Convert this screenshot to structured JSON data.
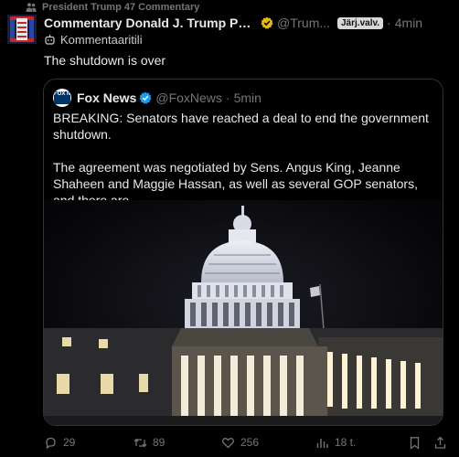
{
  "context": {
    "label": "President Trump 47 Commentary",
    "icon": "people-icon"
  },
  "post": {
    "display_name": "Commentary Donald J. Trump Posts F...",
    "handle": "@Trum...",
    "tag": "Järj.valv.",
    "time": "4min",
    "account_label": "Kommentaaritili",
    "text": "The shutdown is over"
  },
  "quote": {
    "name": "Fox News",
    "handle": "@FoxNews",
    "time": "5min",
    "logo_text": "FOX NEWS",
    "paragraph1": "BREAKING: Senators have reached a deal to end the government shutdown.",
    "paragraph2": "The agreement was negotiated by Sens. Angus King, Jeanne Shaheen and Maggie Hassan, as well as several GOP senators, and there are ..."
  },
  "actions": {
    "replies": "29",
    "reposts": "89",
    "likes": "256",
    "views": "18 t."
  },
  "colors": {
    "background": "#000000",
    "text": "#e7e9ea",
    "muted": "#71767b",
    "verified_gold": "#e2b719",
    "border": "#2f3336"
  }
}
